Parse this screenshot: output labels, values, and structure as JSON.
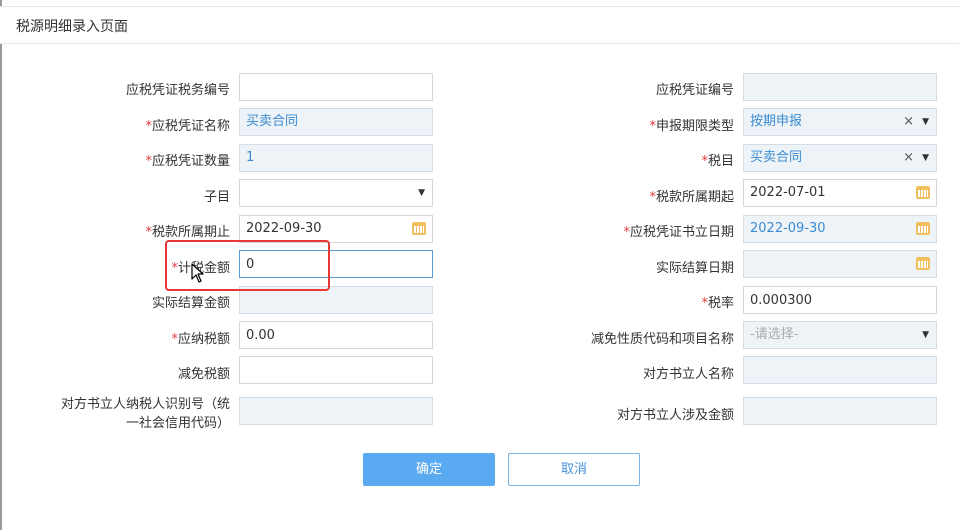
{
  "dialog": {
    "title": "税源明细录入页面"
  },
  "fields": {
    "yspz_swbh": {
      "label": "应税凭证税务编号",
      "value": ""
    },
    "yspz_bh": {
      "label": "应税凭证编号",
      "value": ""
    },
    "yspz_mc": {
      "label": "应税凭证名称",
      "value": "买卖合同"
    },
    "sbqx_lx": {
      "label": "申报期限类型",
      "value": "按期申报"
    },
    "yspz_sl": {
      "label": "应税凭证数量",
      "value": "1"
    },
    "sm": {
      "label": "税目",
      "value": "买卖合同"
    },
    "zm": {
      "label": "子目",
      "value": ""
    },
    "sksq_q": {
      "label": "税款所属期起",
      "value": "2022-07-01"
    },
    "sksq_z": {
      "label": "税款所属期止",
      "value": "2022-09-30"
    },
    "yspz_slrq": {
      "label": "应税凭证书立日期",
      "value": "2022-09-30"
    },
    "jsje": {
      "label": "计税金额",
      "value": "0"
    },
    "sjjs_rq": {
      "label": "实际结算日期",
      "value": ""
    },
    "sjjs_je": {
      "label": "实际结算金额",
      "value": ""
    },
    "sl": {
      "label": "税率",
      "value": "0.000300"
    },
    "ynse": {
      "label": "应纳税额",
      "value": "0.00"
    },
    "jmxz": {
      "label": "减免性质代码和项目名称",
      "placeholder": "-请选择-"
    },
    "jmse": {
      "label": "减免税额",
      "value": ""
    },
    "dfslr_mc": {
      "label": "对方书立人名称",
      "value": ""
    },
    "dfslr_sbh_line1": "对方书立人纳税人识别号（统",
    "dfslr_sbh_line2": "一社会信用代码）",
    "dfslr_sbh_value": "",
    "dfslr_je": {
      "label": "对方书立人涉及金额",
      "value": ""
    }
  },
  "required_mark": "*",
  "clear_glyph": "×",
  "caret_glyph": "▼",
  "buttons": {
    "ok": "确定",
    "cancel": "取消"
  },
  "colors": {
    "required": "#e4393c",
    "readonly_bg": "#eef3f8",
    "readonly_text": "#3a8bd1",
    "primary": "#5aaaf2",
    "highlight": "#e53935"
  }
}
